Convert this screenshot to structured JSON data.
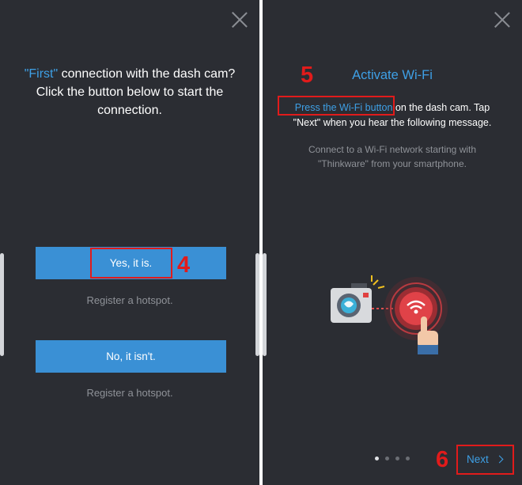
{
  "left_screen": {
    "question_accent": "\"First\"",
    "question_line1_rest": " connection with the dash cam?",
    "question_line2": "Click the button below to start the",
    "question_line3": "connection.",
    "yes_button": "Yes, it is.",
    "register_link_1": "Register a hotspot.",
    "no_button": "No, it isn't.",
    "register_link_2": "Register a hotspot.",
    "step_marker": "4"
  },
  "right_screen": {
    "title": "Activate Wi-Fi",
    "instruction_accent": "Press the Wi-Fi button",
    "instruction_rest": " on the dash cam. Tap",
    "instruction_line2": "\"Next\" when you hear the following message.",
    "message_line1": "Connect to a Wi-Fi network starting with",
    "message_line2": "\"Thinkware\" from your smartphone.",
    "step_marker_5": "5",
    "step_marker_6": "6",
    "next_label": "Next",
    "page_indicator": {
      "total": 4,
      "current": 1
    }
  },
  "colors": {
    "background": "#2b2d33",
    "accent_blue": "#3ea0e6",
    "button_blue": "#3a90d5",
    "annotation_red": "#e11b1b",
    "muted_text": "#8f9298"
  },
  "icons": [
    "close-icon",
    "dash-cam-icon",
    "wifi-button-icon",
    "hand-pointer-icon",
    "chevron-right-icon"
  ]
}
